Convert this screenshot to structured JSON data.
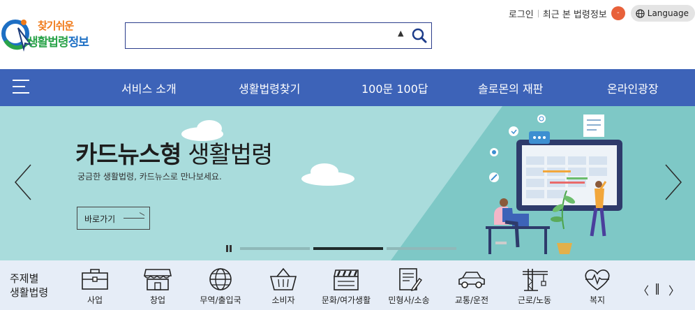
{
  "header": {
    "logo_top": "찾기쉬운",
    "logo_main_green": "생활법령",
    "logo_main_blue": "정보",
    "search": {
      "placeholder": "",
      "value": ""
    },
    "util": {
      "login": "로그인",
      "recent": "최근 본 법령정보",
      "recent_count": "-",
      "language": "Language"
    }
  },
  "nav": {
    "items": [
      "서비스 소개",
      "생활법령찾기",
      "100문 100답",
      "솔로몬의 재판",
      "온라인광장"
    ]
  },
  "hero": {
    "title_bold": "카드뉴스형",
    "title_rest": " 생활법령",
    "subtitle": "궁금한 생활법령, 카드뉴스로 만나보세요.",
    "button": "바로가기",
    "slides": 3,
    "active_slide": 2
  },
  "categories": {
    "label_line1": "주제별",
    "label_line2": "생활법령",
    "items": [
      {
        "name": "사업",
        "icon": "briefcase-icon"
      },
      {
        "name": "창업",
        "icon": "store-icon"
      },
      {
        "name": "무역/출입국",
        "icon": "globe-icon"
      },
      {
        "name": "소비자",
        "icon": "basket-icon"
      },
      {
        "name": "문화/여가생활",
        "icon": "clapperboard-icon"
      },
      {
        "name": "민형사/소송",
        "icon": "document-pen-icon"
      },
      {
        "name": "교통/운전",
        "icon": "car-icon"
      },
      {
        "name": "근로/노동",
        "icon": "crane-icon"
      },
      {
        "name": "복지",
        "icon": "heart-pulse-icon"
      }
    ],
    "controls": {
      "prev": "〈",
      "pause": "‖",
      "next": "〉"
    }
  },
  "colors": {
    "nav": "#3d63b8",
    "hero_bg": "#a9dcdc",
    "category_bg": "#e6edf7",
    "badge": "#e8613a"
  }
}
